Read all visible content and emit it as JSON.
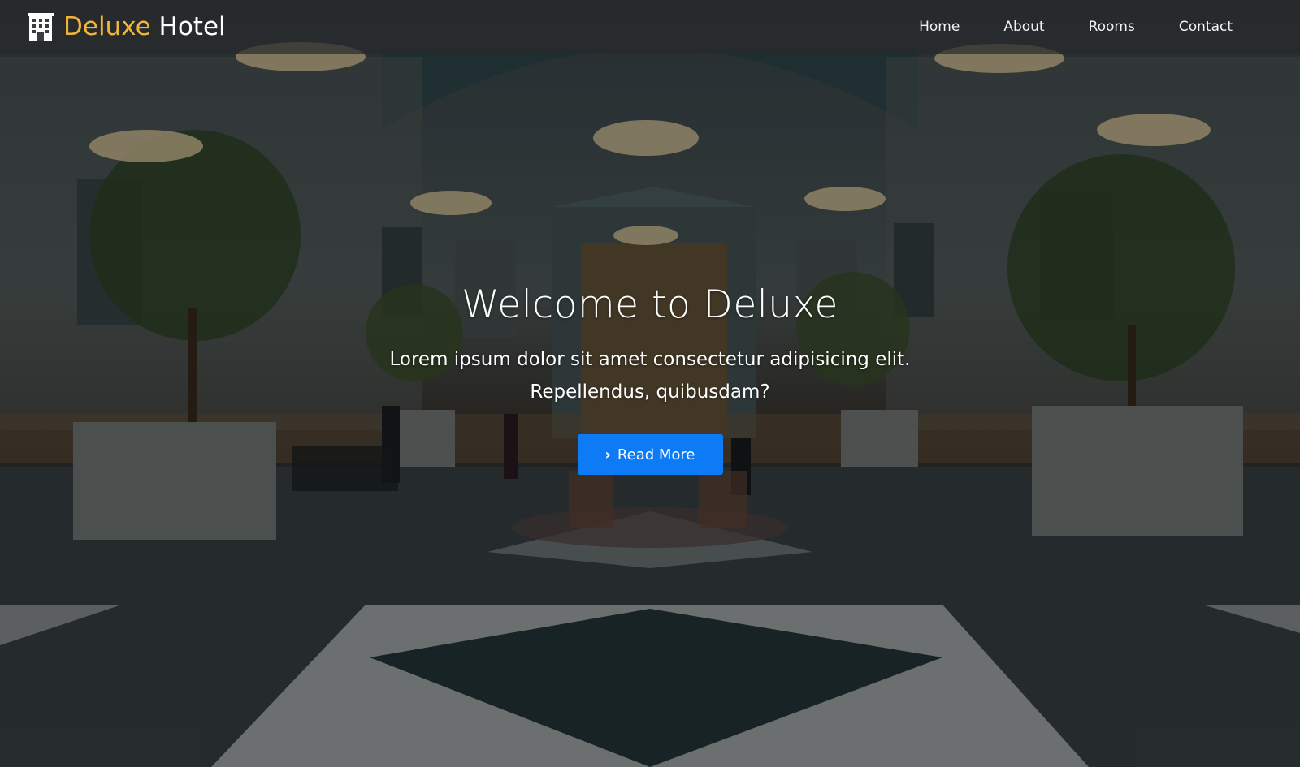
{
  "brand": {
    "name_accent": "Deluxe",
    "name_rest": "Hotel",
    "icon": "hotel-building-icon",
    "accent_color": "#f0b43a"
  },
  "nav": {
    "items": [
      {
        "label": "Home"
      },
      {
        "label": "About"
      },
      {
        "label": "Rooms"
      },
      {
        "label": "Contact"
      }
    ]
  },
  "hero": {
    "title": "Welcome to Deluxe",
    "subtitle_line1": "Lorem ipsum dolor sit amet consectetur adipisicing elit.",
    "subtitle_line2": "Repellendus, quibusdam?",
    "button_label": "Read More",
    "button_icon": "chevron-right-icon",
    "button_color": "#0d7bf5"
  }
}
